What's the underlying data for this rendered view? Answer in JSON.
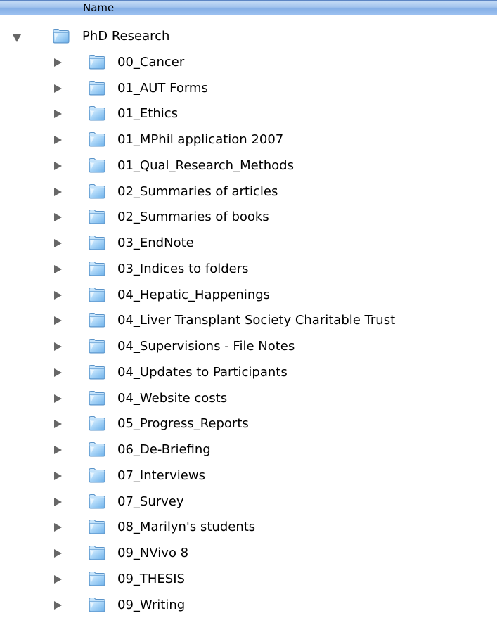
{
  "header": {
    "name_column_label": "Name"
  },
  "root": {
    "label": "PhD Research",
    "icon": "folder-icon",
    "state": "expanded"
  },
  "items": [
    {
      "label": "00_Cancer",
      "icon": "folder-icon"
    },
    {
      "label": "01_AUT Forms",
      "icon": "folder-icon"
    },
    {
      "label": "01_Ethics",
      "icon": "folder-icon"
    },
    {
      "label": "01_MPhil application 2007",
      "icon": "folder-icon"
    },
    {
      "label": "01_Qual_Research_Methods",
      "icon": "folder-icon"
    },
    {
      "label": "02_Summaries of articles",
      "icon": "folder-icon"
    },
    {
      "label": "02_Summaries of books",
      "icon": "folder-icon"
    },
    {
      "label": "03_EndNote",
      "icon": "folder-icon"
    },
    {
      "label": "03_Indices to folders",
      "icon": "folder-icon"
    },
    {
      "label": "04_Hepatic_Happenings",
      "icon": "folder-icon"
    },
    {
      "label": "04_Liver Transplant Society Charitable Trust",
      "icon": "folder-icon"
    },
    {
      "label": "04_Supervisions - File Notes",
      "icon": "folder-icon"
    },
    {
      "label": "04_Updates to Participants",
      "icon": "folder-icon"
    },
    {
      "label": "04_Website costs",
      "icon": "folder-icon"
    },
    {
      "label": "05_Progress_Reports",
      "icon": "folder-icon"
    },
    {
      "label": "06_De-Briefing",
      "icon": "folder-icon"
    },
    {
      "label": "07_Interviews",
      "icon": "folder-icon"
    },
    {
      "label": "07_Survey",
      "icon": "folder-icon"
    },
    {
      "label": "08_Marilyn's students",
      "icon": "folder-icon"
    },
    {
      "label": "09_NVivo 8",
      "icon": "folder-icon"
    },
    {
      "label": "09_THESIS",
      "icon": "folder-icon"
    },
    {
      "label": "09_Writing",
      "icon": "folder-icon"
    }
  ],
  "colors": {
    "header_top": "#c6dcf6",
    "header_bottom": "#86b0e6",
    "disclosure": "#676767",
    "folder_blue": "#8fc6f2",
    "folder_border": "#5a93c8"
  }
}
